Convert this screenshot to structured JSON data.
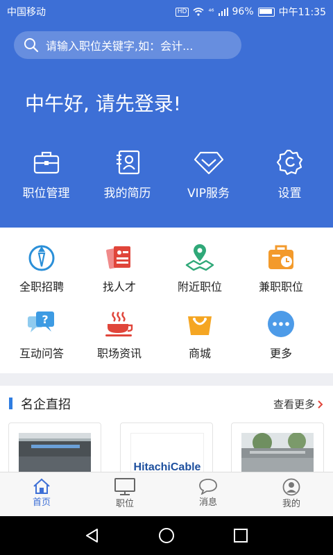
{
  "status": {
    "carrier": "中国移动",
    "hd": "HD",
    "signal": "⁴⁶",
    "battery": "96%",
    "time": "中午11:35"
  },
  "search": {
    "placeholder": "请输入职位关键字,如：会计..."
  },
  "greeting": "中午好, 请先登录!",
  "quick_actions": [
    {
      "label": "职位管理",
      "icon": "briefcase-icon"
    },
    {
      "label": "我的简历",
      "icon": "resume-icon"
    },
    {
      "label": "VIP服务",
      "icon": "vip-diamond-icon"
    },
    {
      "label": "设置",
      "icon": "gear-icon"
    }
  ],
  "grid": [
    {
      "label": "全职招聘",
      "icon": "fulltime-icon"
    },
    {
      "label": "找人才",
      "icon": "find-talent-icon"
    },
    {
      "label": "附近职位",
      "icon": "nearby-map-icon"
    },
    {
      "label": "兼职职位",
      "icon": "parttime-bag-icon"
    },
    {
      "label": "互动问答",
      "icon": "qa-bubble-icon"
    },
    {
      "label": "职场资讯",
      "icon": "coffee-news-icon"
    },
    {
      "label": "商城",
      "icon": "shopping-bag-icon"
    },
    {
      "label": "更多",
      "icon": "more-dots-icon"
    }
  ],
  "companies": {
    "title": "名企直招",
    "more": "查看更多",
    "cards": [
      {
        "logo_text": ""
      },
      {
        "logo_text": "HitachiCable"
      },
      {
        "logo_text": ""
      }
    ]
  },
  "tabs": [
    {
      "label": "首页",
      "icon": "home-icon"
    },
    {
      "label": "职位",
      "icon": "monitor-icon"
    },
    {
      "label": "消息",
      "icon": "chat-icon"
    },
    {
      "label": "我的",
      "icon": "profile-icon"
    }
  ],
  "colors": {
    "brand": "#3d6fd6",
    "accent_orange": "#f39a2b",
    "accent_red": "#e0453a",
    "accent_green": "#2fa878"
  }
}
